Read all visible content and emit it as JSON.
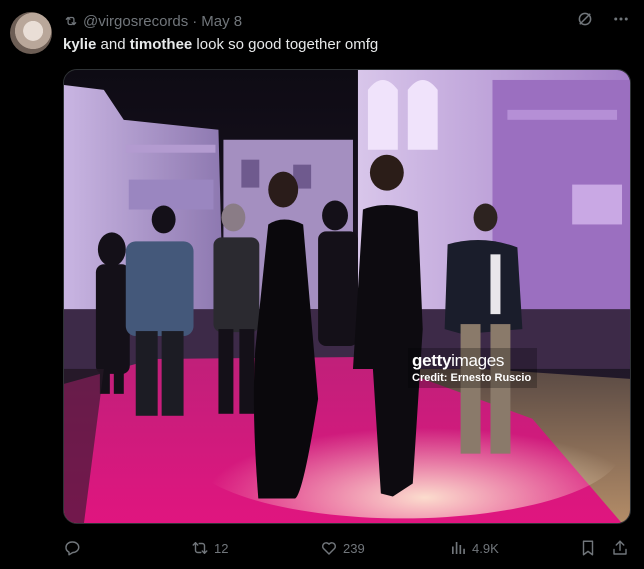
{
  "tweet": {
    "handle": "@virgosrecords",
    "separator": "·",
    "date": "May 8",
    "text_name1": "kylie",
    "text_and": " and ",
    "text_name2": "timothee",
    "text_rest": " look so good together omfg"
  },
  "media": {
    "watermark_brand_bold": "getty",
    "watermark_brand_light": "images",
    "watermark_credit": "Credit: Ernesto Ruscio"
  },
  "actions": {
    "reply_count": "",
    "retweet_count": "12",
    "like_count": "239",
    "views_count": "4.9K"
  },
  "icons": [
    "retweet-small-icon",
    "grok-icon",
    "more-icon",
    "reply-icon",
    "retweet-icon",
    "like-icon",
    "views-icon",
    "bookmark-icon",
    "share-icon"
  ]
}
